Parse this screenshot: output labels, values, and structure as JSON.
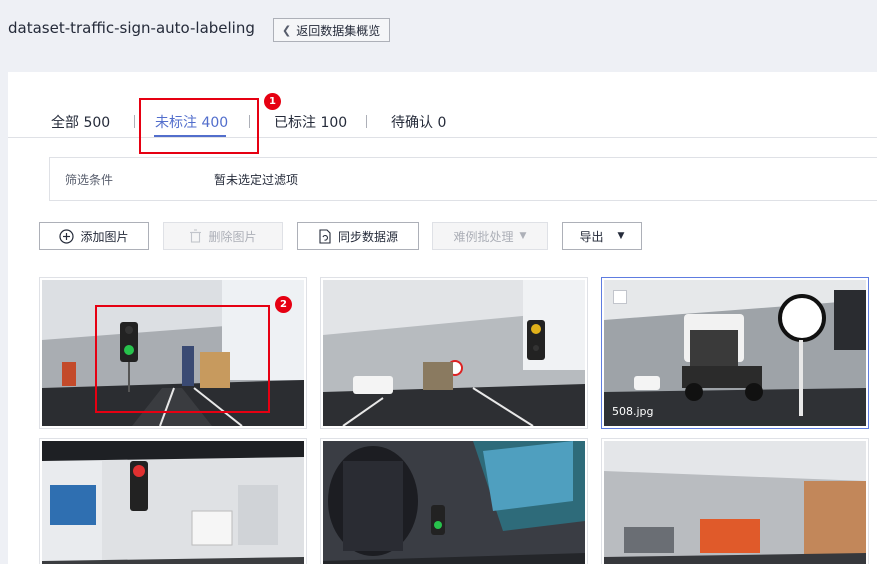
{
  "header": {
    "dataset_name": "dataset-traffic-sign-auto-labeling",
    "back_label": "返回数据集概览"
  },
  "tabs": [
    {
      "label": "全部 500"
    },
    {
      "label": "未标注 400"
    },
    {
      "label": "已标注 100"
    },
    {
      "label": "待确认 0"
    }
  ],
  "filter": {
    "label": "筛选条件",
    "value": "暂未选定过滤项"
  },
  "toolbar": {
    "add_label": "添加图片",
    "delete_label": "删除图片",
    "sync_label": "同步数据源",
    "hard_label": "难例批处理",
    "export_label": "导出"
  },
  "annotations": {
    "badge_1": "1",
    "badge_2": "2"
  },
  "images": [
    {
      "name": ""
    },
    {
      "name": ""
    },
    {
      "name": "508.jpg"
    },
    {
      "name": ""
    },
    {
      "name": ""
    },
    {
      "name": ""
    }
  ],
  "colors": {
    "accent": "#526ecc",
    "highlight": "#e60012"
  }
}
